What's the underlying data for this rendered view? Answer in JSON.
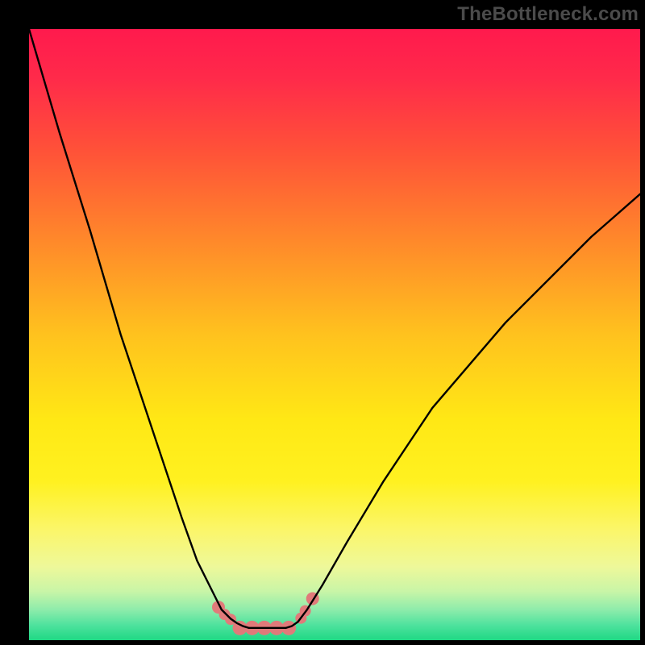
{
  "watermark": "TheBottleneck.com",
  "chart_data": {
    "type": "line",
    "title": "",
    "xlabel": "",
    "ylabel": "",
    "xlim": [
      0,
      100
    ],
    "ylim": [
      0,
      100
    ],
    "grid": false,
    "legend": false,
    "series": [
      {
        "name": "curve-1-left-descent",
        "x": [
          0,
          5,
          10,
          15,
          20,
          25,
          27.5,
          30,
          31.5,
          33,
          34,
          35,
          36
        ],
        "y": [
          100,
          83,
          67,
          50,
          35,
          20,
          13,
          8,
          5,
          3.5,
          2.8,
          2.3,
          2
        ],
        "color": "#000000"
      },
      {
        "name": "curve-2-right-ascent",
        "x": [
          42,
          43,
          44,
          45.5,
          48,
          52,
          58,
          66,
          78,
          92,
          100
        ],
        "y": [
          2,
          2.3,
          3,
          5,
          9,
          16,
          26,
          38,
          52,
          66,
          73
        ],
        "color": "#000000"
      },
      {
        "name": "floor-segment",
        "x": [
          36,
          42
        ],
        "y": [
          2,
          2
        ],
        "color": "#000000"
      }
    ],
    "markers": [
      {
        "name": "left-cluster-1",
        "x": 31.0,
        "y": 5.4,
        "r": 8,
        "color": "#e07a7a"
      },
      {
        "name": "left-cluster-2",
        "x": 32.0,
        "y": 4.2,
        "r": 7,
        "color": "#e07a7a"
      },
      {
        "name": "left-cluster-3",
        "x": 33.0,
        "y": 3.4,
        "r": 7,
        "color": "#e07a7a"
      },
      {
        "name": "right-cluster-1",
        "x": 44.5,
        "y": 3.6,
        "r": 7,
        "color": "#e07a7a"
      },
      {
        "name": "right-cluster-2",
        "x": 45.2,
        "y": 4.8,
        "r": 7,
        "color": "#e07a7a"
      },
      {
        "name": "right-cluster-3",
        "x": 46.4,
        "y": 6.8,
        "r": 8,
        "color": "#e07a7a"
      },
      {
        "name": "floor-1",
        "x": 34.5,
        "y": 2.0,
        "r": 9,
        "color": "#e07a7a"
      },
      {
        "name": "floor-2",
        "x": 36.5,
        "y": 2.0,
        "r": 9,
        "color": "#e07a7a"
      },
      {
        "name": "floor-3",
        "x": 38.5,
        "y": 2.0,
        "r": 9,
        "color": "#e07a7a"
      },
      {
        "name": "floor-4",
        "x": 40.5,
        "y": 2.0,
        "r": 9,
        "color": "#e07a7a"
      },
      {
        "name": "floor-5",
        "x": 42.5,
        "y": 2.0,
        "r": 9,
        "color": "#e07a7a"
      }
    ],
    "background": {
      "type": "vertical-gradient",
      "stops": [
        {
          "pos": 0.0,
          "color": "#ff1a4d"
        },
        {
          "pos": 0.08,
          "color": "#ff2a4a"
        },
        {
          "pos": 0.2,
          "color": "#ff5238"
        },
        {
          "pos": 0.35,
          "color": "#ff8a2a"
        },
        {
          "pos": 0.5,
          "color": "#ffc21e"
        },
        {
          "pos": 0.64,
          "color": "#ffe815"
        },
        {
          "pos": 0.74,
          "color": "#fff120"
        },
        {
          "pos": 0.82,
          "color": "#fbf66a"
        },
        {
          "pos": 0.88,
          "color": "#eef89a"
        },
        {
          "pos": 0.92,
          "color": "#c9f5a7"
        },
        {
          "pos": 0.95,
          "color": "#8eecab"
        },
        {
          "pos": 0.975,
          "color": "#4fe29e"
        },
        {
          "pos": 1.0,
          "color": "#1fd884"
        }
      ]
    }
  }
}
